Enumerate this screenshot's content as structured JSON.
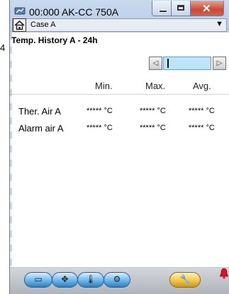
{
  "page": {
    "stray_char": "4"
  },
  "window": {
    "title": "00:000 AK-CC 750A",
    "close_glyph": "✕"
  },
  "case_select": {
    "value": "Case A",
    "arrow": "▼"
  },
  "history": {
    "title": "Temp. History A - 24h",
    "nav_prev_glyph": "◁",
    "nav_next_glyph": "▷"
  },
  "table": {
    "columns": [
      "Min.",
      "Max.",
      "Avg."
    ],
    "rows": [
      {
        "label": "Ther. Air A",
        "min": "***** °C",
        "max": "***** °C",
        "avg": "***** °C"
      },
      {
        "label": "Alarm air A",
        "min": "***** °C",
        "max": "***** °C",
        "avg": "***** °C"
      }
    ]
  },
  "toolbar": {
    "buttons": [
      {
        "icon": "controller-unit-icon",
        "glyph": "▭"
      },
      {
        "icon": "fan-valve-icon",
        "glyph": "✥"
      },
      {
        "icon": "thermometer-icon",
        "glyph": "🌡"
      },
      {
        "icon": "parameters-icon",
        "glyph": "⚙"
      },
      {
        "icon": "wrench-icon",
        "glyph": "🔧"
      }
    ],
    "alarm_color": "#e0102a"
  },
  "colors": {
    "accent": "#6cb6ea",
    "service": "#f4c648",
    "window_bg": "#dfe8f3"
  }
}
